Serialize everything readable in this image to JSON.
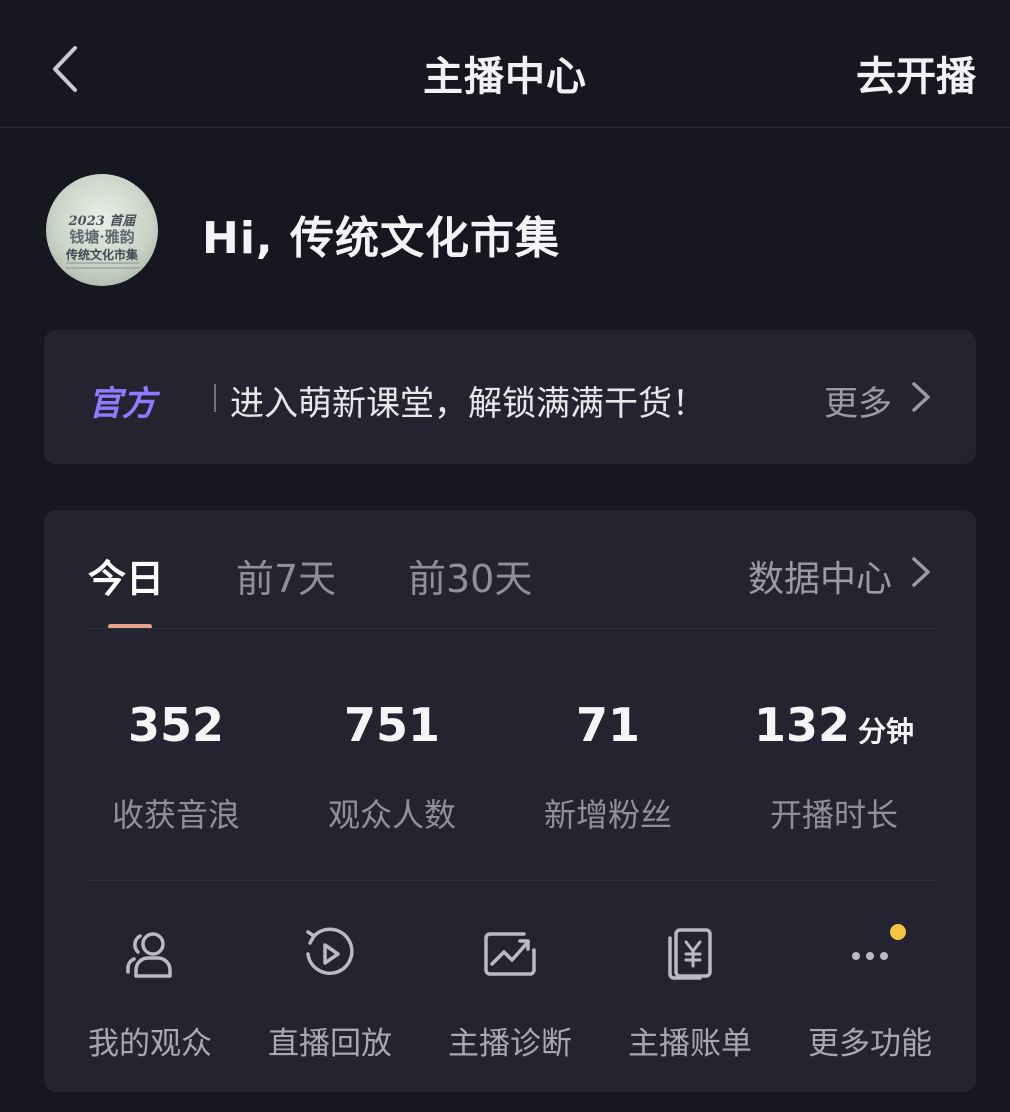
{
  "nav": {
    "title": "主播中心",
    "action": "去开播"
  },
  "profile": {
    "greeting": "Hi, 传统文化市集",
    "avatar_text": [
      "2023 首届",
      "钱塘·雅韵",
      "传统文化市集"
    ]
  },
  "banner": {
    "tag": "官方",
    "text": "进入萌新课堂，解锁满满干货！",
    "more": "更多"
  },
  "stats_card": {
    "tabs": [
      {
        "label": "今日",
        "active": true
      },
      {
        "label": "前7天",
        "active": false
      },
      {
        "label": "前30天",
        "active": false
      }
    ],
    "data_center": "数据中心",
    "metrics": [
      {
        "value": "352",
        "unit": "",
        "label": "收获音浪"
      },
      {
        "value": "751",
        "unit": "",
        "label": "观众人数"
      },
      {
        "value": "71",
        "unit": "",
        "label": "新增粉丝"
      },
      {
        "value": "132",
        "unit": "分钟",
        "label": "开播时长"
      }
    ],
    "functions": [
      {
        "label": "我的观众",
        "icon": "audience-icon"
      },
      {
        "label": "直播回放",
        "icon": "replay-icon"
      },
      {
        "label": "主播诊断",
        "icon": "diagnosis-icon"
      },
      {
        "label": "主播账单",
        "icon": "bill-icon"
      },
      {
        "label": "更多功能",
        "icon": "more-icon",
        "has_notification": true
      }
    ]
  },
  "colors": {
    "background": "#161721",
    "card": "#23242f",
    "accent_purple": "#8e7bff",
    "tab_indicator": "#e9a08e",
    "notification_dot": "#f5c542"
  }
}
